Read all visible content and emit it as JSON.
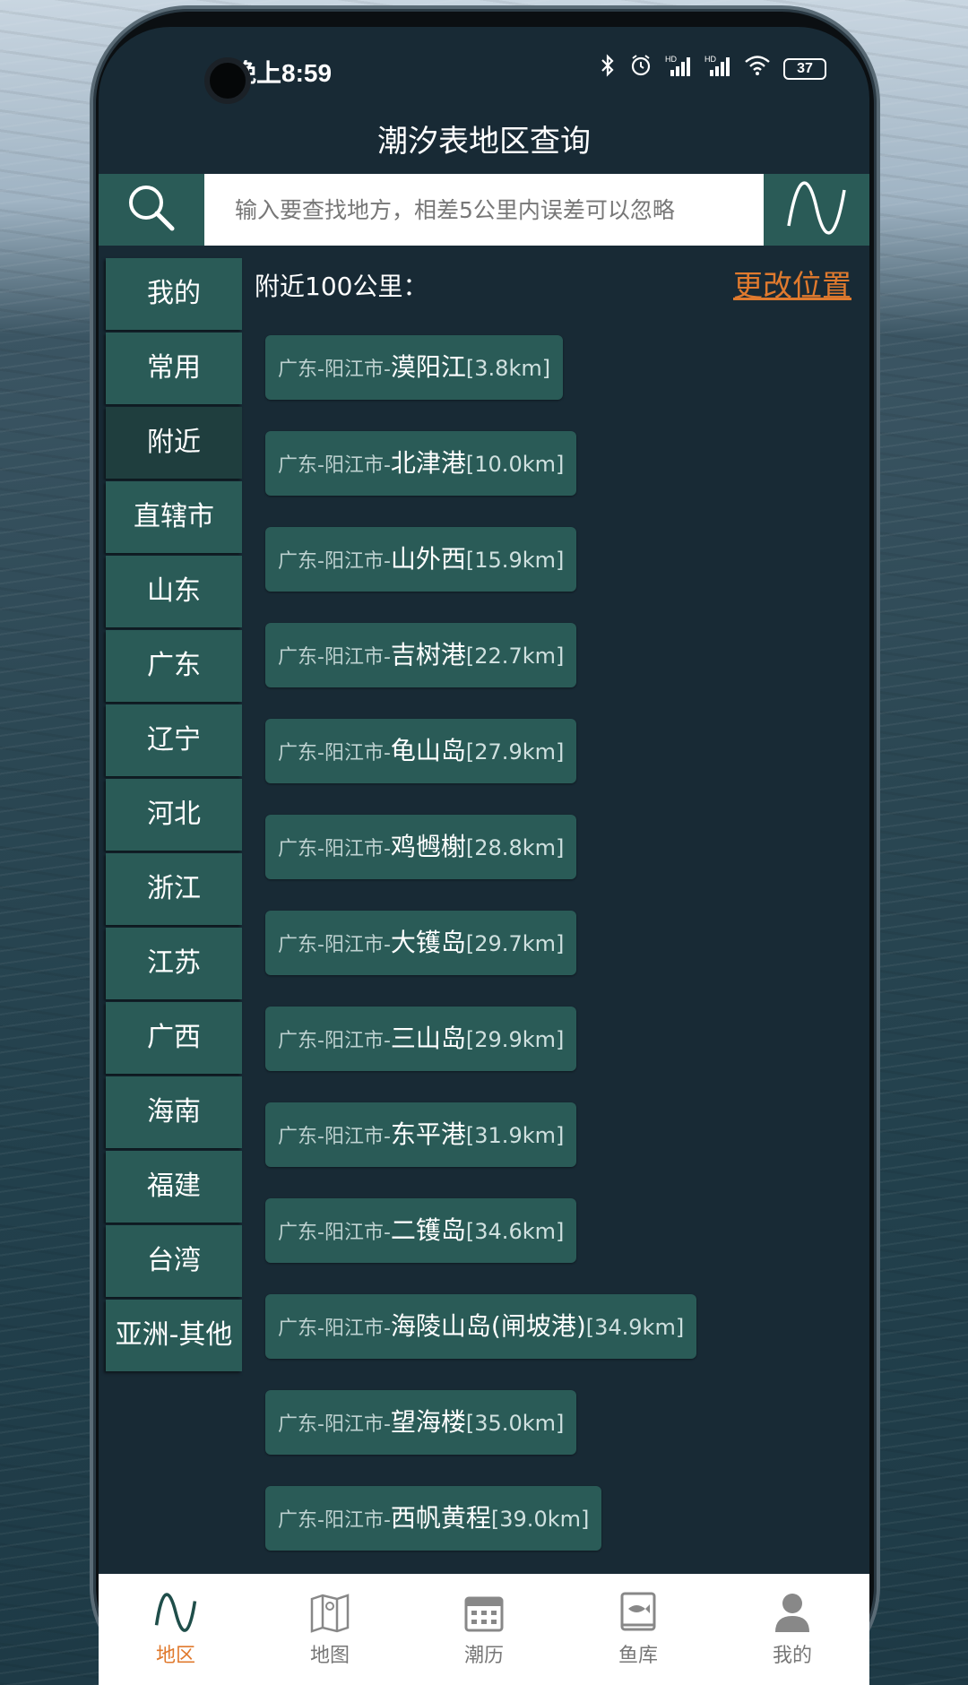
{
  "status": {
    "time": "晚上8:59",
    "battery": "37",
    "hd1": "HD",
    "hd2": "HD"
  },
  "header": {
    "title": "潮汐表地区查询"
  },
  "search": {
    "placeholder": "输入要查找地方，相差5公里内误差可以忽略"
  },
  "sidebar": {
    "items": [
      {
        "label": "我的",
        "active": false
      },
      {
        "label": "常用",
        "active": false
      },
      {
        "label": "附近",
        "active": true
      },
      {
        "label": "直辖市",
        "active": false
      },
      {
        "label": "山东",
        "active": false
      },
      {
        "label": "广东",
        "active": false
      },
      {
        "label": "辽宁",
        "active": false
      },
      {
        "label": "河北",
        "active": false
      },
      {
        "label": "浙江",
        "active": false
      },
      {
        "label": "江苏",
        "active": false
      },
      {
        "label": "广西",
        "active": false
      },
      {
        "label": "海南",
        "active": false
      },
      {
        "label": "福建",
        "active": false
      },
      {
        "label": "台湾",
        "active": false
      },
      {
        "label": "亚洲-其他",
        "active": false
      }
    ]
  },
  "main": {
    "nearby_label": "附近100公里：",
    "change_location": "更改位置",
    "locations": [
      {
        "prefix": "广东-阳江市-",
        "name": "漠阳江",
        "dist": "[3.8km]"
      },
      {
        "prefix": "广东-阳江市-",
        "name": "北津港",
        "dist": "[10.0km]"
      },
      {
        "prefix": "广东-阳江市-",
        "name": "山外西",
        "dist": "[15.9km]"
      },
      {
        "prefix": "广东-阳江市-",
        "name": "吉树港",
        "dist": "[22.7km]"
      },
      {
        "prefix": "广东-阳江市-",
        "name": "龟山岛",
        "dist": "[27.9km]"
      },
      {
        "prefix": "广东-阳江市-",
        "name": "鸡乸榭",
        "dist": "[28.8km]"
      },
      {
        "prefix": "广东-阳江市-",
        "name": "大镬岛",
        "dist": "[29.7km]"
      },
      {
        "prefix": "广东-阳江市-",
        "name": "三山岛",
        "dist": "[29.9km]"
      },
      {
        "prefix": "广东-阳江市-",
        "name": "东平港",
        "dist": "[31.9km]"
      },
      {
        "prefix": "广东-阳江市-",
        "name": "二镬岛",
        "dist": "[34.6km]"
      },
      {
        "prefix": "广东-阳江市-",
        "name": "海陵山岛(闸坡港)",
        "dist": "[34.9km]"
      },
      {
        "prefix": "广东-阳江市-",
        "name": "望海楼",
        "dist": "[35.0km]"
      },
      {
        "prefix": "广东-阳江市-",
        "name": "西帆黄程",
        "dist": "[39.0km]"
      }
    ]
  },
  "bottom_nav": {
    "items": [
      {
        "label": "地区",
        "icon": "wave-icon",
        "active": true
      },
      {
        "label": "地图",
        "icon": "map-icon",
        "active": false
      },
      {
        "label": "潮历",
        "icon": "calendar-icon",
        "active": false
      },
      {
        "label": "鱼库",
        "icon": "fish-book-icon",
        "active": false
      },
      {
        "label": "我的",
        "icon": "user-icon",
        "active": false
      }
    ]
  },
  "colors": {
    "accent": "#e07a2e",
    "teal": "#2a5b57",
    "background": "#182a35"
  }
}
